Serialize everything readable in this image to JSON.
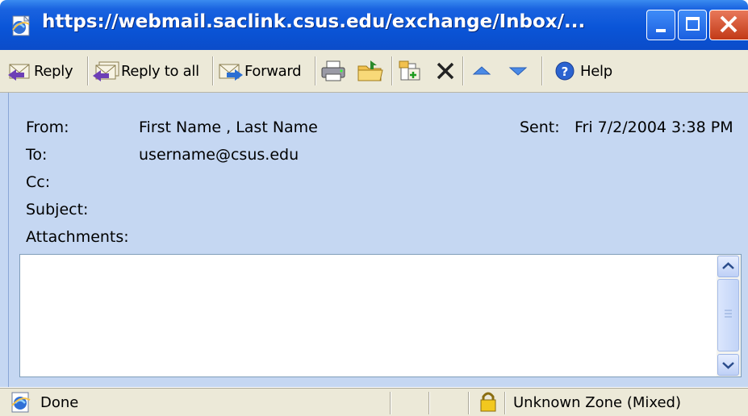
{
  "window": {
    "title": "https://webmail.saclink.csus.edu/exchange/Inbox/..."
  },
  "toolbar": {
    "reply_label": "Reply",
    "reply_all_label": "Reply to all",
    "forward_label": "Forward",
    "help_label": "Help"
  },
  "header": {
    "from_label": "From:",
    "from_value": "First Name , Last Name",
    "to_label": "To:",
    "to_value": "username@csus.edu",
    "cc_label": "Cc:",
    "subject_label": "Subject:",
    "attachments_label": "Attachments:",
    "sent_label": "Sent:",
    "sent_value": "Fri 7/2/2004 3:38 PM"
  },
  "status": {
    "text": "Done",
    "zone": "Unknown Zone (Mixed)"
  },
  "colors": {
    "titlebar": "#0a55d8",
    "header_bg": "#c5d7f2",
    "toolbar_bg": "#ece9d8"
  },
  "icons": [
    "ie-page-icon",
    "minimize-icon",
    "maximize-icon",
    "close-icon",
    "reply-icon",
    "reply-all-icon",
    "forward-icon",
    "print-icon",
    "move-folder-icon",
    "copy-icon",
    "delete-icon",
    "up-arrow-icon",
    "down-arrow-icon",
    "help-icon",
    "ie-icon",
    "lock-icon"
  ]
}
